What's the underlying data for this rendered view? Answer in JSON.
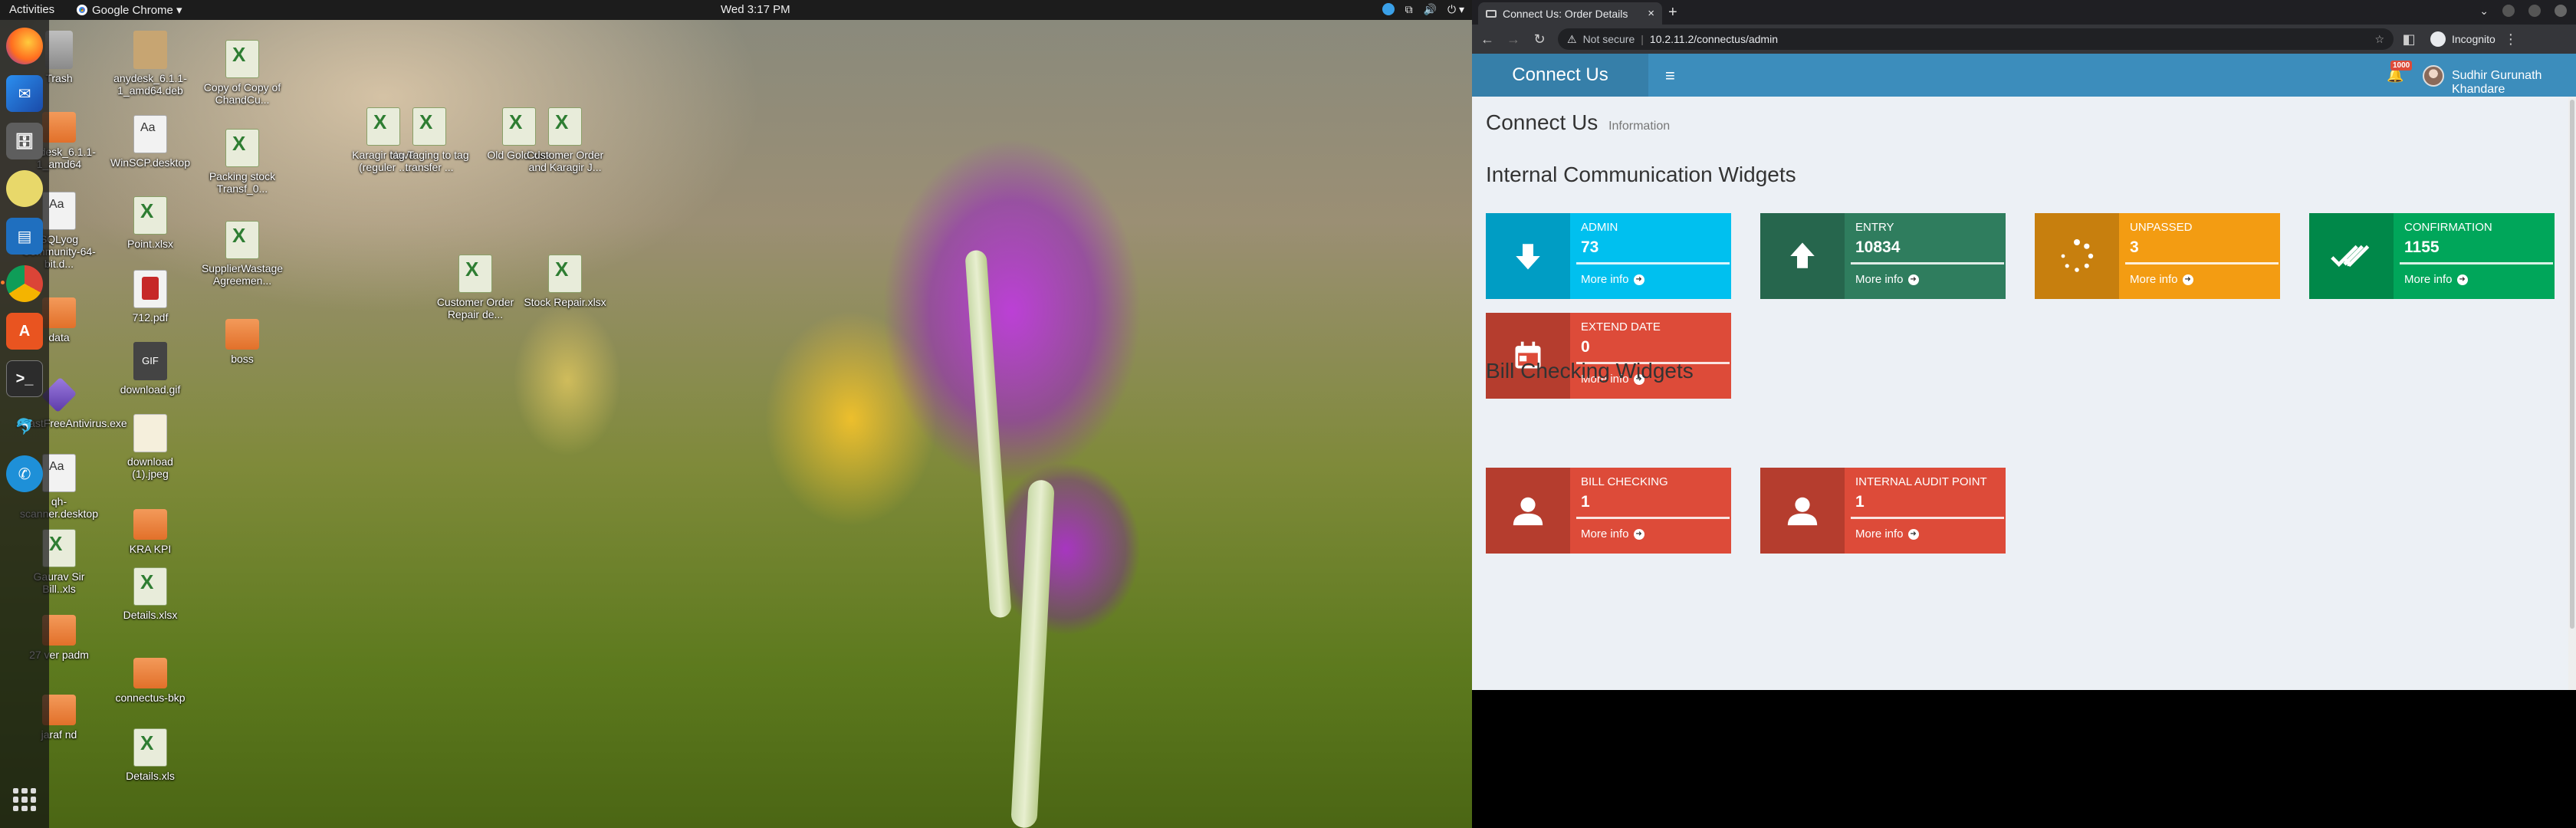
{
  "topbar": {
    "activities": "Activities",
    "app_name": "Google Chrome ▾",
    "clock": "Wed 3:17 PM"
  },
  "dock": {
    "items": [
      "firefox-icon",
      "thunderbird-icon",
      "files-icon",
      "rhythmbox-icon",
      "writer-icon",
      "chrome-icon",
      "software-icon",
      "terminal-icon",
      "dolphin-icon",
      "phone-icon"
    ]
  },
  "desktop": {
    "icons": [
      {
        "label": "Trash",
        "kind": "trash"
      },
      {
        "label": "anydesk_6.1.1-1_amd64",
        "kind": "folder"
      },
      {
        "label": "SQLyog Community-64-bit.d...",
        "kind": "doc"
      },
      {
        "label": "data",
        "kind": "folder"
      },
      {
        "label": "AvastFreeAntivirus.exe",
        "kind": "exe"
      },
      {
        "label": "qh-scanner.desktop",
        "kind": "doc"
      },
      {
        "label": "Gaurav Sir Bill..xls",
        "kind": "xls"
      },
      {
        "label": "27 ver padm",
        "kind": "folder"
      },
      {
        "label": "jaraf nd",
        "kind": "folder"
      },
      {
        "label": "anydesk_6.1.1-1_amd64.deb",
        "kind": "deb"
      },
      {
        "label": "WinSCP.desktop",
        "kind": "doc"
      },
      {
        "label": "Point.xlsx",
        "kind": "xls"
      },
      {
        "label": "712.pdf",
        "kind": "pdf"
      },
      {
        "label": "download.gif",
        "kind": "gif"
      },
      {
        "label": "download (1).jpeg",
        "kind": "img"
      },
      {
        "label": "KRA KPI",
        "kind": "folder"
      },
      {
        "label": "Details.xlsx",
        "kind": "xls"
      },
      {
        "label": "connectus-bkp",
        "kind": "folder"
      },
      {
        "label": "Details.xls",
        "kind": "xls"
      },
      {
        "label": "Copy of Copy of ChandCu...",
        "kind": "xls"
      },
      {
        "label": "Packing stock Transf_0...",
        "kind": "xls"
      },
      {
        "label": "SupplierWastage Agreemen...",
        "kind": "xls"
      },
      {
        "label": "boss",
        "kind": "folder"
      },
      {
        "label": "Karagir Nave (reguler ...",
        "kind": "xls"
      },
      {
        "label": "tag Taging to tag transfer ...",
        "kind": "xls"
      },
      {
        "label": "Old Gold.xlsx",
        "kind": "xls"
      },
      {
        "label": "Customer Order and Karagir J...",
        "kind": "xls"
      },
      {
        "label": "Customer Order Repair de...",
        "kind": "xls"
      },
      {
        "label": "Stock Repair.xlsx",
        "kind": "xls"
      }
    ]
  },
  "browser": {
    "tab_title": "Connect Us: Order Details",
    "tab_close": "×",
    "new_tab": "+",
    "back": "←",
    "forward": "→",
    "reload": "↻",
    "not_secure": "Not secure",
    "url": "10.2.11.2/connectus/admin",
    "star": "☆",
    "incognito": "Incognito"
  },
  "app": {
    "logo": "Connect Us",
    "hamburger": "≡",
    "notification_count": "1000",
    "user_name": "Sudhir Gurunath Khandare",
    "page_title": "Connect Us",
    "page_subtitle": "Information",
    "more_info": "More info",
    "section_internal": "Internal Communication Widgets",
    "section_bill": "Bill Checking Widgets",
    "internal_widgets": [
      {
        "label": "ADMIN",
        "value": "73",
        "color": "#00c0ef",
        "icon": "arrow-down-icon"
      },
      {
        "label": "ENTRY",
        "value": "10834",
        "color": "#2f7d5e",
        "icon": "arrow-up-icon"
      },
      {
        "label": "UNPASSED",
        "value": "3",
        "color": "#f39c12",
        "icon": "spinner-icon"
      },
      {
        "label": "CONFIRMATION",
        "value": "1155",
        "color": "#00a65a",
        "icon": "double-check-icon"
      },
      {
        "label": "EXTEND DATE",
        "value": "0",
        "color": "#dd4b39",
        "icon": "calendar-icon"
      }
    ],
    "bill_widgets": [
      {
        "label": "BILL CHECKING",
        "value": "1",
        "color": "#dd4b39",
        "icon": "user-icon"
      },
      {
        "label": "INTERNAL AUDIT POINT",
        "value": "1",
        "color": "#dd4b39",
        "icon": "user-icon"
      }
    ]
  }
}
